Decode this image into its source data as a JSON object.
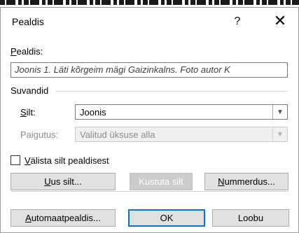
{
  "dialog": {
    "title": "Pealdis",
    "help": "?",
    "close": "✕"
  },
  "caption": {
    "label": "Pealdis:",
    "label_access_key": "P",
    "label_rest": "ealdis:",
    "value": "Joonis 1. Läti kõrgeim mägi Gaizinkalns. Foto autor K"
  },
  "options": {
    "group_label": "Suvandid",
    "label_field": {
      "label_access_key": "S",
      "label_rest": "ilt:",
      "value": "Joonis"
    },
    "position_field": {
      "label": "Paigutus:",
      "value": "Valitud üksuse alla"
    },
    "exclude_label": {
      "checked": false,
      "access_key": "V",
      "rest": "älista silt pealdisest"
    }
  },
  "buttons": {
    "new_label": {
      "access_key": "U",
      "rest": "us silt..."
    },
    "delete_label": "Kustuta silt",
    "numbering": {
      "access_key": "N",
      "rest": "ummerdus..."
    },
    "autocaption": {
      "access_key": "A",
      "rest": "utomaatpealdis..."
    },
    "ok": "OK",
    "cancel": "Loobu"
  },
  "colors": {
    "accent": "#0078d7",
    "button_bg": "#e1e1e1",
    "disabled_bg": "#cccccc"
  }
}
